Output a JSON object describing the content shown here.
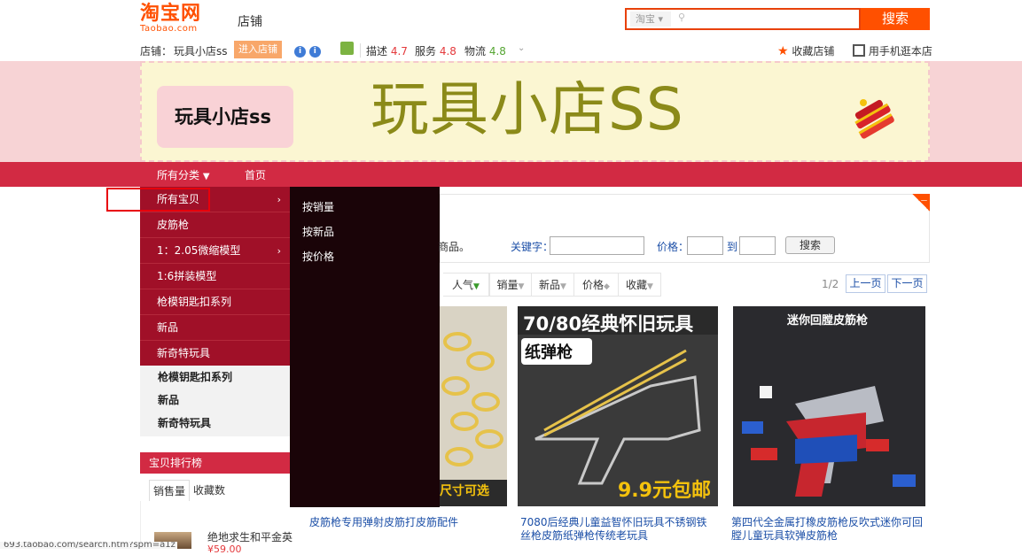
{
  "header": {
    "logo_cn": "淘宝网",
    "logo_en": "Taobao.com",
    "section_label": "店铺",
    "search_scope": "淘宝",
    "search_placeholder": "",
    "search_button": "搜索"
  },
  "shop_bar": {
    "shop_prefix": "店铺：",
    "shop_name": "玩具小店ss",
    "enter_button": "进入店铺",
    "desc_label": "描述",
    "desc_score": "4.7",
    "service_label": "服务",
    "service_score": "4.8",
    "logistics_label": "物流",
    "logistics_score": "4.8",
    "favorite_link": "收藏店铺",
    "mobile_link": "用手机逛本店"
  },
  "banner": {
    "shop_name": "玩具小店ss",
    "title": "玩具小店SS"
  },
  "nav": {
    "all_categories": "所有分类",
    "home": "首页"
  },
  "categories": [
    {
      "label": "所有宝贝",
      "has_arrow": true
    },
    {
      "label": "皮筋枪",
      "has_arrow": false
    },
    {
      "label": "1：2.05微缩模型",
      "has_arrow": true
    },
    {
      "label": "1:6拼装模型",
      "has_arrow": false
    },
    {
      "label": "枪模钥匙扣系列",
      "has_arrow": false
    },
    {
      "label": "新品",
      "has_arrow": false
    },
    {
      "label": "新奇特玩具",
      "has_arrow": false
    }
  ],
  "categories_light": [
    "枪模钥匙扣系列",
    "新品",
    "新奇特玩具"
  ],
  "submenu": [
    "按销量",
    "按新品",
    "按价格"
  ],
  "ranking": {
    "title": "宝贝排行榜",
    "tab_sales": "销售量",
    "tab_favorites": "收藏数",
    "item_name": "绝地求生和平金英",
    "item_price": "¥59.00"
  },
  "filter": {
    "goods_hint": "商品。",
    "keyword_label": "关键字：",
    "price_label": "价格：",
    "price_to": "到",
    "search_button": "搜索",
    "corner": "－"
  },
  "sort": {
    "popularity": "人气",
    "sales": "销量",
    "new": "新品",
    "price": "价格",
    "favorites": "收藏",
    "page_indicator": "1/2",
    "prev_page": "上一页",
    "next_page": "下一页"
  },
  "products": [
    {
      "title": "皮筋枪专用弹射皮筋打皮筋配件",
      "image_text_bottom": "尺寸可选"
    },
    {
      "title": "7080后经典儿童益智怀旧玩具不锈钢铁丝枪皮筋纸弹枪传统老玩具",
      "image_text_top": "70/80经典怀旧玩具",
      "image_text_mid": "纸弹枪",
      "image_text_bottom": "9.9元包邮"
    },
    {
      "title": "第四代全金属打橡皮筋枪反吹式迷你可回膛儿童玩具软弹皮筋枪",
      "image_text_top": "迷你回膛皮筋枪"
    }
  ],
  "status_url": "693.taobao.com/search.htm?spm=a1z"
}
